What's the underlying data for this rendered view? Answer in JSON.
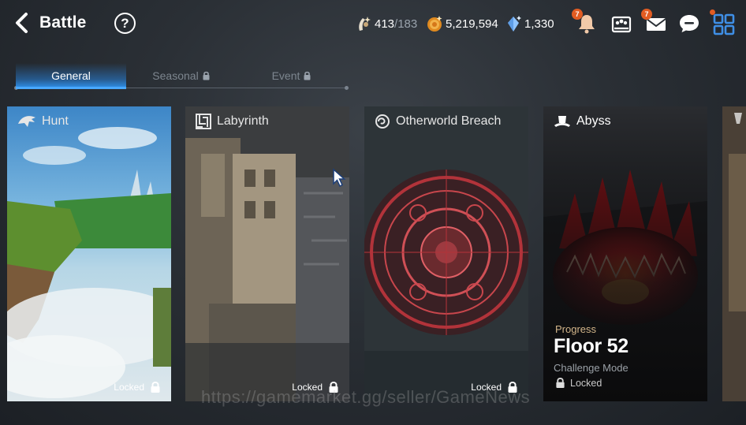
{
  "header": {
    "title": "Battle",
    "help_label": "?",
    "stamina": {
      "current": "413",
      "max": "/183"
    },
    "gold": "5,219,594",
    "crystals": "1,330",
    "notification_badge": "7",
    "mail_badge": "7"
  },
  "tabs": [
    {
      "label": "General",
      "active": true
    },
    {
      "label": "Seasonal",
      "active": false,
      "locked": true
    },
    {
      "label": "Event",
      "active": false,
      "locked": true
    }
  ],
  "cards": [
    {
      "title": "Hunt",
      "status": "Locked"
    },
    {
      "title": "Labyrinth",
      "status": "Locked"
    },
    {
      "title": "Otherworld Breach",
      "status": "Locked"
    },
    {
      "title": "Abyss",
      "progress_label": "Progress",
      "floor": "Floor 52",
      "mode": "Challenge Mode",
      "status": "Locked"
    }
  ],
  "watermark": "https://gamemarket.gg/seller/GameNews",
  "colors": {
    "accent_tab": "#2f92ee",
    "badge": "#e25c22",
    "progress_label": "#d2b58a",
    "menu_icon": "#3f8fe6"
  },
  "icons": [
    "back-arrow-icon",
    "help-icon",
    "stamina-icon",
    "gold-coin-icon",
    "crystal-icon",
    "bell-icon",
    "guild-icon",
    "mail-icon",
    "chat-icon",
    "menu-grid-icon",
    "dragon-icon",
    "maze-icon",
    "portal-icon",
    "hat-icon",
    "lock-icon"
  ]
}
